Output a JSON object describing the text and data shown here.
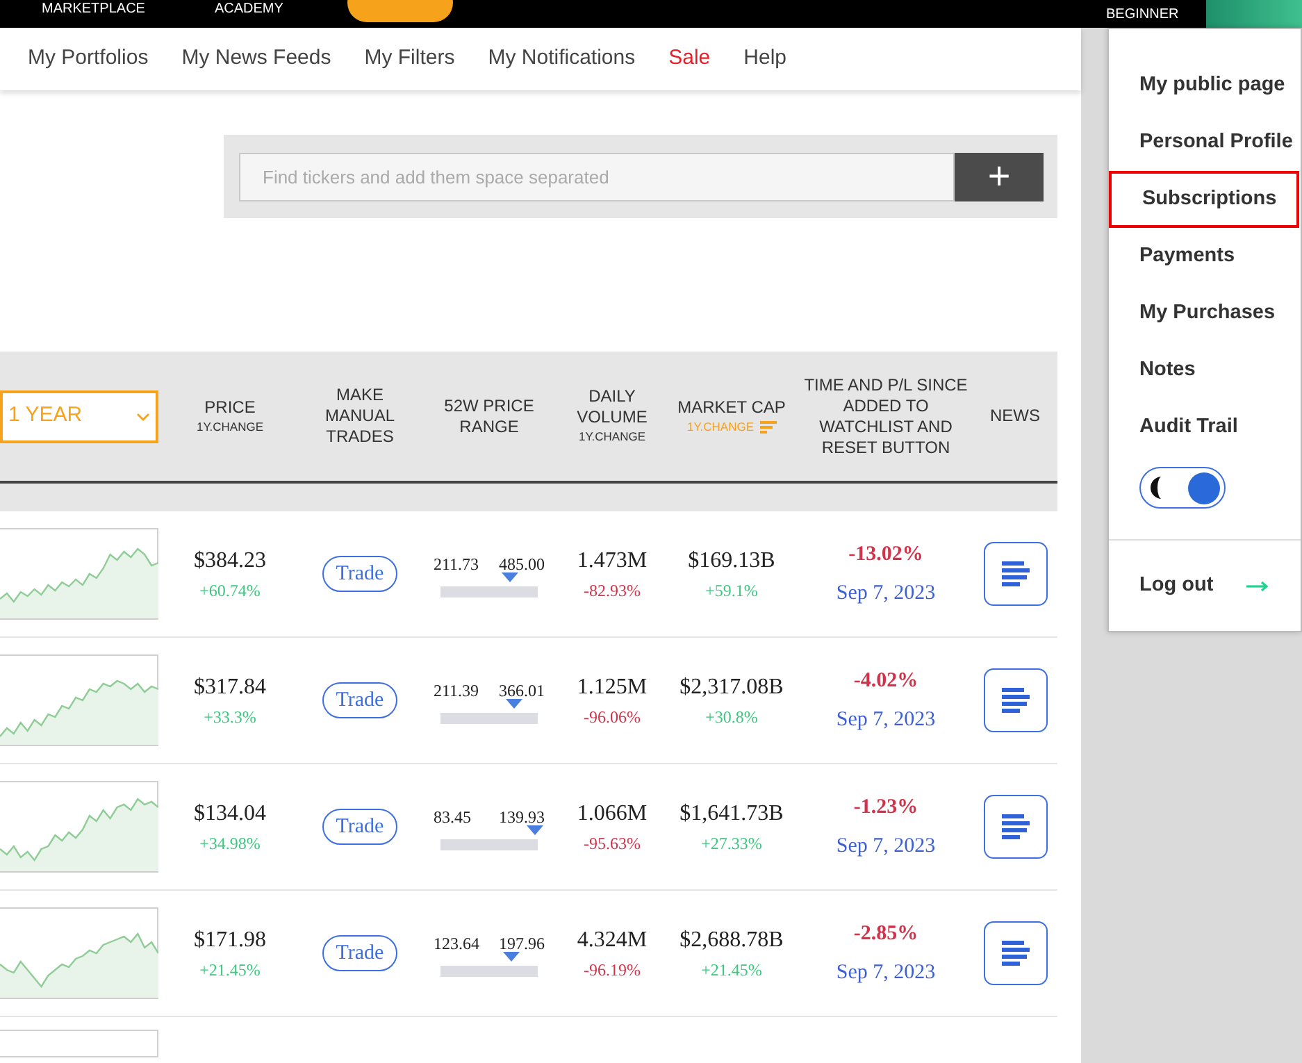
{
  "top_bar": {
    "links": [
      "MARKETPLACE",
      "ACADEMY"
    ],
    "level_label": "BEGINNER"
  },
  "nav": [
    {
      "label": "My Portfolios",
      "kind": "normal"
    },
    {
      "label": "My News Feeds",
      "kind": "normal"
    },
    {
      "label": "My Filters",
      "kind": "normal"
    },
    {
      "label": "My Notifications",
      "kind": "normal"
    },
    {
      "label": "Sale",
      "kind": "sale"
    },
    {
      "label": "Help",
      "kind": "normal"
    }
  ],
  "search": {
    "placeholder": "Find tickers and add them space separated",
    "button": "+"
  },
  "table": {
    "period": "1 YEAR",
    "columns": [
      {
        "title": "PRICE",
        "sub": "1Y.CHANGE",
        "sorted": false
      },
      {
        "title": "MAKE MANUAL TRADES",
        "sorted": false
      },
      {
        "title": "52W PRICE RANGE",
        "sorted": false
      },
      {
        "title": "DAILY VOLUME",
        "sub": "1Y.CHANGE",
        "sorted": false
      },
      {
        "title": "MARKET CAP",
        "sub": "1Y.CHANGE",
        "sorted": true
      },
      {
        "title": "TIME AND P/L SINCE ADDED TO WATCHLIST AND RESET BUTTON",
        "sorted": false
      },
      {
        "title": "NEWS",
        "sorted": false
      }
    ],
    "rows": [
      {
        "price": "$384.23",
        "price_change": "+60.74%",
        "trade": "Trade",
        "low": "211.73",
        "high": "485.00",
        "level": 0.72,
        "volume": "1.473M",
        "volume_change": "-82.93%",
        "cap": "$169.13B",
        "cap_change": "+59.1%",
        "pl": "-13.02%",
        "date": "Sep 7, 2023"
      },
      {
        "price": "$317.84",
        "price_change": "+33.3%",
        "trade": "Trade",
        "low": "211.39",
        "high": "366.01",
        "level": 0.76,
        "volume": "1.125M",
        "volume_change": "-96.06%",
        "cap": "$2,317.08B",
        "cap_change": "+30.8%",
        "pl": "-4.02%",
        "date": "Sep 7, 2023"
      },
      {
        "price": "$134.04",
        "price_change": "+34.98%",
        "trade": "Trade",
        "low": "83.45",
        "high": "139.93",
        "level": 0.97,
        "volume": "1.066M",
        "volume_change": "-95.63%",
        "cap": "$1,641.73B",
        "cap_change": "+27.33%",
        "pl": "-1.23%",
        "date": "Sep 7, 2023"
      },
      {
        "price": "$171.98",
        "price_change": "+21.45%",
        "trade": "Trade",
        "low": "123.64",
        "high": "197.96",
        "level": 0.73,
        "volume": "4.324M",
        "volume_change": "-96.19%",
        "cap": "$2,688.78B",
        "cap_change": "+21.45%",
        "pl": "-2.85%",
        "date": "Sep 7, 2023"
      }
    ]
  },
  "menu": {
    "items": [
      {
        "label": "My public page",
        "selected": false
      },
      {
        "label": "Personal Profile",
        "selected": false
      },
      {
        "label": "Subscriptions",
        "selected": true
      },
      {
        "label": "Payments",
        "selected": false
      },
      {
        "label": "My Purchases",
        "selected": false
      },
      {
        "label": "Notes",
        "selected": false
      },
      {
        "label": "Audit Trail",
        "selected": false
      }
    ],
    "dark_mode": {
      "on": true
    },
    "logout": "Log out"
  }
}
